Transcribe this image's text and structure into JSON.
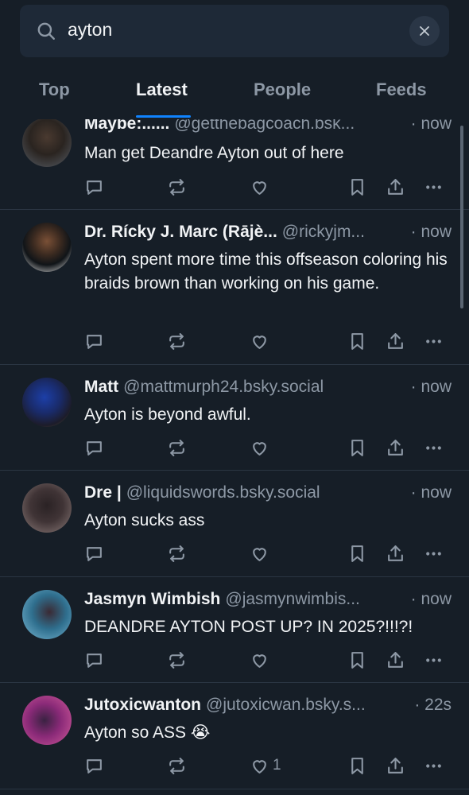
{
  "search": {
    "query": "ayton",
    "clear_icon": "close-icon"
  },
  "tabs": [
    {
      "label": "Top"
    },
    {
      "label": "Latest"
    },
    {
      "label": "People"
    },
    {
      "label": "Feeds"
    }
  ],
  "active_tab": "Latest",
  "colors": {
    "background": "#161e27",
    "accent": "#1083fe",
    "muted": "#8d98a5"
  },
  "posts": [
    {
      "name": "Maybe:......",
      "handle": "@getthebagcoach.bsk...",
      "time": "· now",
      "text": "Man get Deandre Ayton out of here",
      "like_count": ""
    },
    {
      "name": "Dr. Rícky J. Marc (Rājè...",
      "handle": "@rickyjm...",
      "time": "· now",
      "text": "Ayton spent more time this offseason coloring his braids brown than working on his game.",
      "like_count": ""
    },
    {
      "name": "Matt",
      "handle": "@mattmurph24.bsky.social",
      "time": "· now",
      "text": "Ayton is beyond awful.",
      "like_count": ""
    },
    {
      "name": "Dre |",
      "handle": "@liquidswords.bsky.social",
      "time": "· now",
      "text": "Ayton sucks ass",
      "like_count": ""
    },
    {
      "name": "Jasmyn Wimbish",
      "handle": "@jasmynwimbis...",
      "time": "· now",
      "text": "DEANDRE AYTON POST UP? IN 2025?!!!?!",
      "like_count": ""
    },
    {
      "name": "Jutoxicwanton",
      "handle": "@jutoxicwan.bsky.s...",
      "time": "· 22s",
      "text": "Ayton so ASS 😭",
      "like_count": "1"
    }
  ]
}
